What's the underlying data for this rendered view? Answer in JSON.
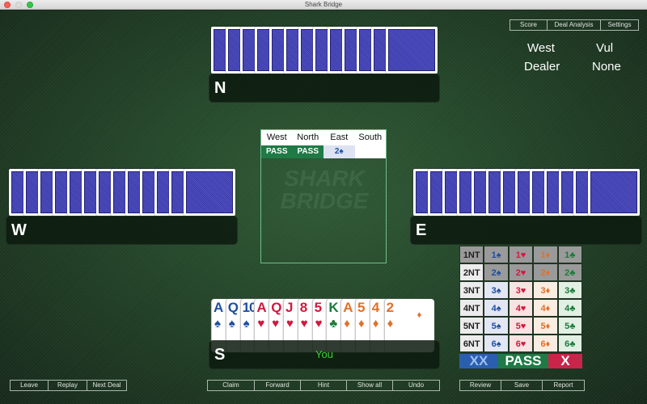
{
  "window": {
    "title": "Shark Bridge"
  },
  "top_menu": [
    "Score",
    "Deal Analysis",
    "Settings"
  ],
  "info": {
    "dealer_value": "West",
    "dealer_label": "Dealer",
    "vul_label": "Vul",
    "vul_value": "None"
  },
  "seats": {
    "north": {
      "label": "N",
      "player": "",
      "cards_count": 13
    },
    "west": {
      "label": "W",
      "player": "",
      "cards_count": 13
    },
    "east": {
      "label": "E",
      "player": "",
      "cards_count": 13
    },
    "south": {
      "label": "S",
      "player": "You"
    }
  },
  "auction": {
    "headers": [
      "West",
      "North",
      "East",
      "South"
    ],
    "bids": [
      "PASS",
      "PASS",
      "2♠",
      ""
    ]
  },
  "south_hand": [
    {
      "rank": "A",
      "suit": "♠",
      "color": "#1e4fa0"
    },
    {
      "rank": "Q",
      "suit": "♠",
      "color": "#1e4fa0"
    },
    {
      "rank": "10",
      "suit": "♠",
      "color": "#1e4fa0"
    },
    {
      "rank": "A",
      "suit": "♥",
      "color": "#d0193e"
    },
    {
      "rank": "Q",
      "suit": "♥",
      "color": "#d0193e"
    },
    {
      "rank": "J",
      "suit": "♥",
      "color": "#d0193e"
    },
    {
      "rank": "8",
      "suit": "♥",
      "color": "#d0193e"
    },
    {
      "rank": "5",
      "suit": "♥",
      "color": "#d0193e"
    },
    {
      "rank": "K",
      "suit": "♣",
      "color": "#1b7a3a"
    },
    {
      "rank": "A",
      "suit": "♦",
      "color": "#e0712a"
    },
    {
      "rank": "5",
      "suit": "♦",
      "color": "#e0712a"
    },
    {
      "rank": "4",
      "suit": "♦",
      "color": "#e0712a"
    },
    {
      "rank": "2",
      "suit": "♦",
      "color": "#e0712a"
    }
  ],
  "bidding_box": {
    "rows": [
      [
        "1NT",
        "1♠",
        "1♥",
        "1♦",
        "1♣"
      ],
      [
        "2NT",
        "2♠",
        "2♥",
        "2♦",
        "2♣"
      ],
      [
        "3NT",
        "3♠",
        "3♥",
        "3♦",
        "3♣"
      ],
      [
        "4NT",
        "4♠",
        "4♥",
        "4♦",
        "4♣"
      ],
      [
        "5NT",
        "5♠",
        "5♥",
        "5♦",
        "5♣"
      ],
      [
        "6NT",
        "6♠",
        "6♥",
        "6♦",
        "6♣"
      ]
    ],
    "disabled_rows": 2,
    "redouble": "XX",
    "pass": "PASS",
    "double": "X",
    "colors": {
      "nt": "#222222",
      "spades": "#1e4fa0",
      "hearts": "#d0193e",
      "diamonds": "#e0712a",
      "clubs": "#1b7a3a",
      "pass_bg": "#1f7a45",
      "double_bg": "#c9244a",
      "redouble_bg": "#2a5fae"
    }
  },
  "bottom_left": [
    "Leave",
    "Replay",
    "Next Deal"
  ],
  "bottom_center": [
    "Claim",
    "Forward",
    "Hint",
    "Show all",
    "Undo"
  ],
  "bottom_right": [
    "Review",
    "Save",
    "Report"
  ]
}
